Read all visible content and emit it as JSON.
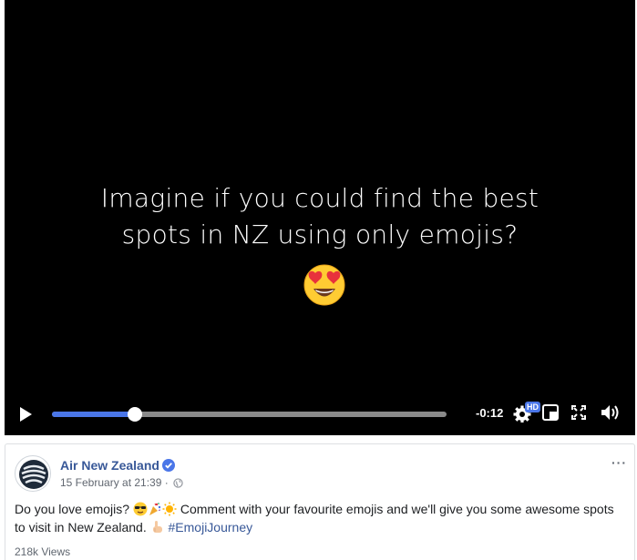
{
  "video": {
    "caption_line1": "Imagine if you could find the best",
    "caption_line2": "spots in NZ using only emojis?",
    "caption_emoji": "heart-eyes-emoji",
    "progress": 0.21,
    "time_remaining": "-0:12",
    "hd_label": "HD",
    "accent_color": "#4a76e8"
  },
  "post": {
    "page_name": "Air New Zealand",
    "timestamp": "15 February at 21:39",
    "meta_separator": "·",
    "more_label": "···",
    "text_part1": "Do you love emojis?",
    "text_part2": "Comment with your favourite emojis and we'll give you some awesome spots to visit in New Zealand.",
    "hashtag": "#EmojiJourney",
    "views": "218k Views",
    "link_color": "#385898"
  }
}
